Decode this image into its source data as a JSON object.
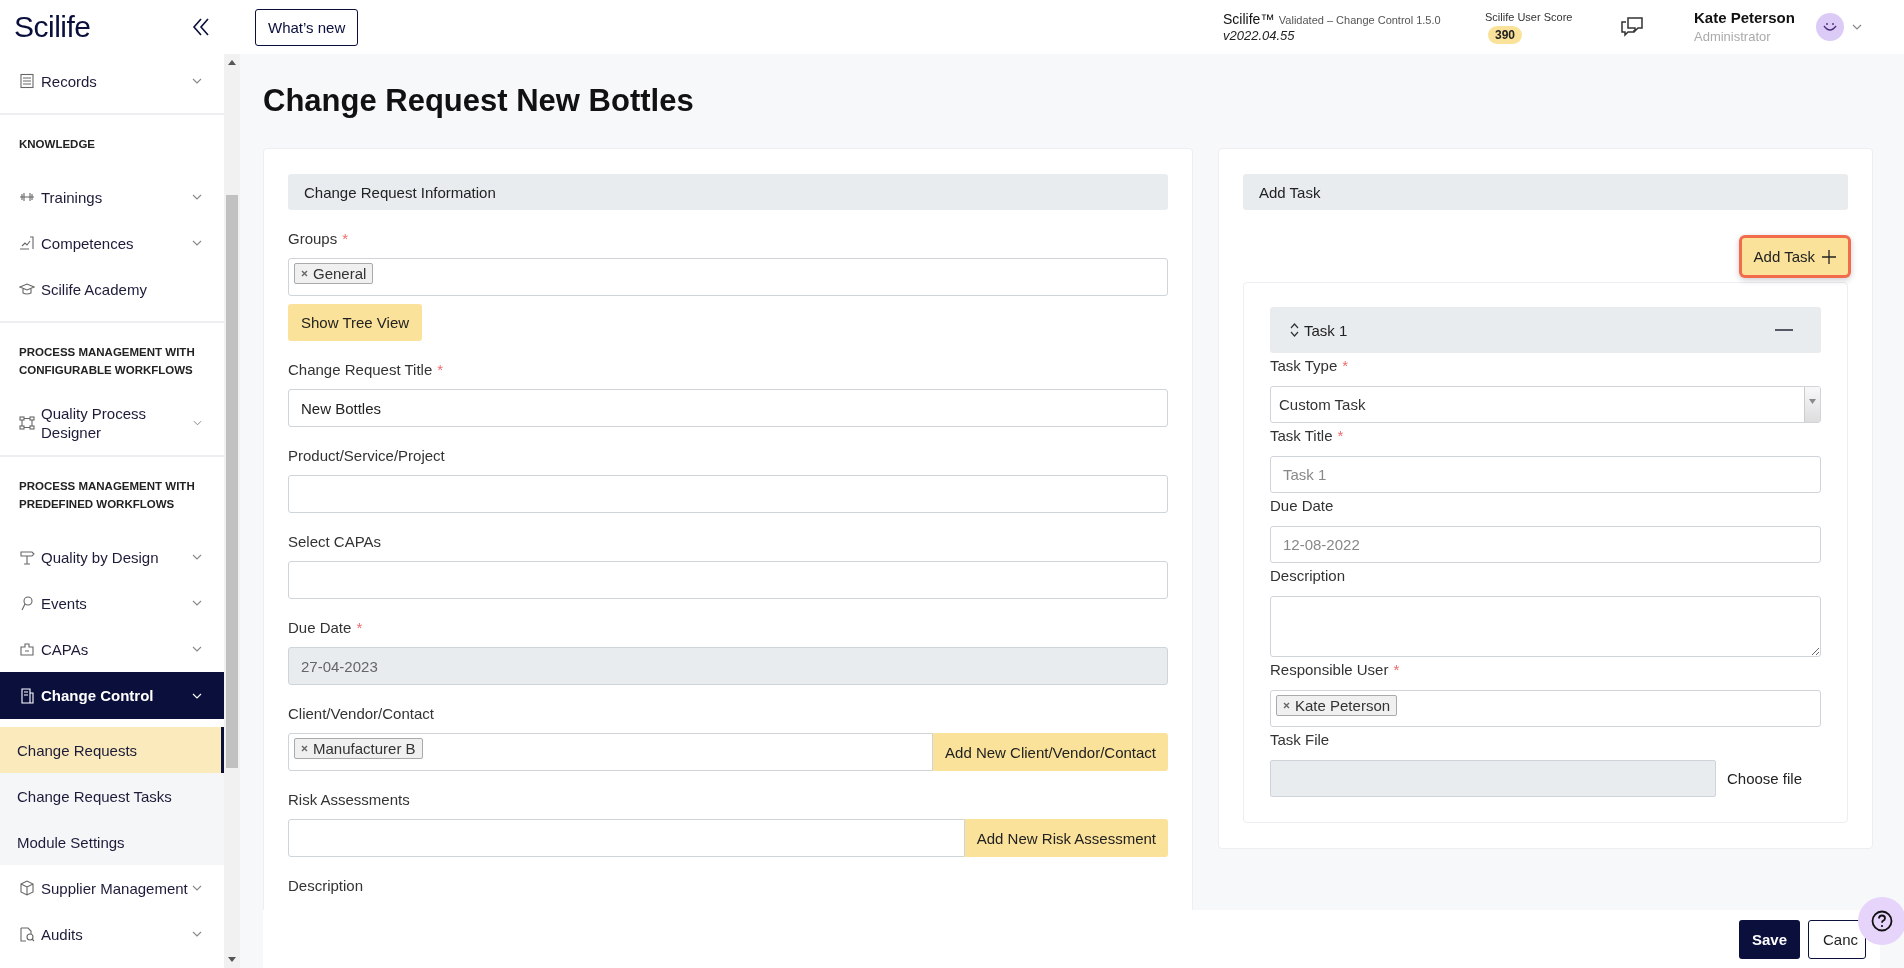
{
  "app": {
    "logo": "Scilife",
    "whats_new": "What’s new"
  },
  "header": {
    "product": "Scilife™",
    "validation": "Validated – Change Control 1.5.0",
    "version": "v2022.04.55",
    "score_label": "Scilife User Score",
    "score": "390",
    "user_name": "Kate Peterson",
    "user_role": "Administrator"
  },
  "sidebar": {
    "items": [
      {
        "kind": "item",
        "label": "Records",
        "expandable": true,
        "selected": false
      },
      {
        "kind": "heading",
        "label": "KNOWLEDGE"
      },
      {
        "kind": "item",
        "label": "Trainings",
        "expandable": true,
        "selected": false
      },
      {
        "kind": "item",
        "label": "Competences",
        "expandable": true,
        "selected": false
      },
      {
        "kind": "item",
        "label": "Scilife Academy",
        "expandable": false,
        "selected": false
      },
      {
        "kind": "heading",
        "label": "PROCESS MANAGEMENT WITH CONFIGURABLE WORKFLOWS"
      },
      {
        "kind": "item",
        "label": "Quality Process Designer",
        "expandable": true,
        "selected": false
      },
      {
        "kind": "heading",
        "label": "PROCESS MANAGEMENT WITH PREDEFINED WORKFLOWS"
      },
      {
        "kind": "item",
        "label": "Quality by Design",
        "expandable": true,
        "selected": false
      },
      {
        "kind": "item",
        "label": "Events",
        "expandable": true,
        "selected": false
      },
      {
        "kind": "item",
        "label": "CAPAs",
        "expandable": true,
        "selected": false
      },
      {
        "kind": "item",
        "label": "Change Control",
        "expandable": true,
        "selected": true,
        "expanded": true,
        "children": [
          {
            "label": "Change Requests",
            "selected": true
          },
          {
            "label": "Change Request Tasks",
            "selected": false
          },
          {
            "label": "Module Settings",
            "selected": false
          }
        ]
      },
      {
        "kind": "item",
        "label": "Supplier Management",
        "expandable": true,
        "selected": false
      },
      {
        "kind": "item",
        "label": "Audits",
        "expandable": true,
        "selected": false
      }
    ]
  },
  "page": {
    "title": "Change Request New Bottles"
  },
  "form": {
    "title": "Change Request Information",
    "fields": [
      {
        "kind": "tags",
        "label": "Groups",
        "required_mark": "*",
        "tags": [
          "General"
        ]
      },
      {
        "kind": "action",
        "button": "Show Tree View"
      },
      {
        "kind": "input",
        "label": "Change Request Title",
        "required_mark": "*",
        "value": "New Bottles",
        "disabled": false
      },
      {
        "kind": "input",
        "label": "Product/Service/Project",
        "disabled": false
      },
      {
        "kind": "input",
        "label": "Select CAPAs",
        "disabled": false
      },
      {
        "kind": "input",
        "label": "Due Date",
        "required_mark": "*",
        "value": "27-04-2023",
        "disabled": true
      },
      {
        "kind": "tags_button",
        "label": "Client/Vendor/Contact",
        "tags": [
          "Manufacturer B"
        ],
        "button": "Add New Client/Vendor/Contact"
      },
      {
        "kind": "input_button",
        "label": "Risk Assessments",
        "button": "Add New Risk Assessment"
      },
      {
        "kind": "label",
        "label": "Description"
      }
    ]
  },
  "tasks_panel": {
    "title": "Add Task",
    "add_button": "Add Task",
    "highlighted": true,
    "tasks": [
      {
        "title": "Task 1",
        "fields": [
          {
            "kind": "select",
            "label": "Task Type",
            "required_mark": "*",
            "value": "Custom Task"
          },
          {
            "kind": "input",
            "label": "Task Title",
            "required_mark": "*",
            "placeholder": "Task 1"
          },
          {
            "kind": "input",
            "label": "Due Date",
            "placeholder": "12-08-2022"
          },
          {
            "kind": "textarea",
            "label": "Description"
          },
          {
            "kind": "tags",
            "label": "Responsible User",
            "required_mark": "*",
            "tags": [
              "Kate Peterson"
            ]
          },
          {
            "kind": "file",
            "label": "Task File",
            "button": "Choose file"
          }
        ]
      }
    ]
  },
  "footer": {
    "save": "Save",
    "cancel": "Canc"
  }
}
